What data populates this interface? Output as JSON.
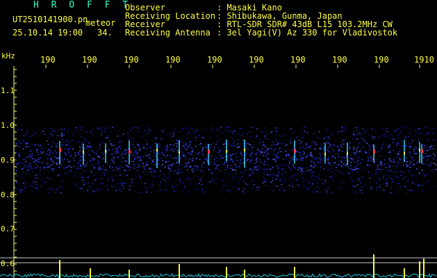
{
  "header": {
    "brand": "H R O F F T",
    "filename": "UT2510141900.pn",
    "mode": "meteor",
    "datetime": "25.10.14 19:00",
    "count": "34.",
    "fields": [
      {
        "label": "Observer",
        "value": ": Masaki Kano"
      },
      {
        "label": "Receiving Location",
        "value": ": Shibukawa, Gunma, Japan"
      },
      {
        "label": "Receiver",
        "value": ": RTL-SDR SDR# 43dB L15 103.2MHz CW"
      },
      {
        "label": "Receiving Antenna",
        "value": ": 3el Yagi(V) Az 330 for Vladivostok"
      }
    ]
  },
  "axis": {
    "unit": "kHz",
    "y_ticks": [
      "1.1",
      "1.0",
      "0.9",
      "0.8",
      "0.7",
      "0.6"
    ],
    "time_ticks": [
      "190",
      "190",
      "190",
      "190",
      "190",
      "190",
      "190",
      "190",
      "190",
      "1910"
    ]
  },
  "colors": {
    "label": "#ffff44",
    "brand": "#33ffcc",
    "tick": "#ffff66",
    "noise": "#1a1aa0",
    "signal": "#ff3355",
    "baseline": "#20c8e0",
    "spike": "#ffff33"
  }
}
